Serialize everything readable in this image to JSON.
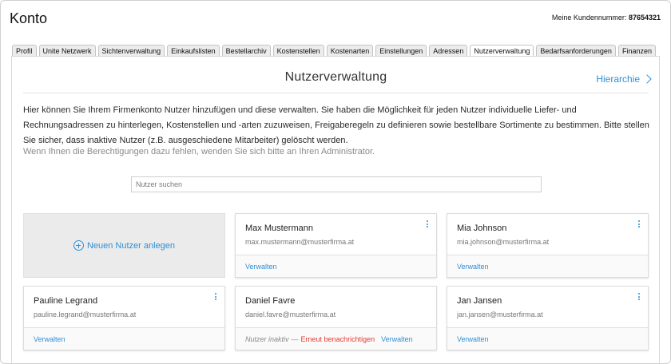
{
  "header": {
    "title": "Konto",
    "customer_label": "Meine Kundennummer:",
    "customer_number": "87654321"
  },
  "tabs": [
    {
      "label": "Profil"
    },
    {
      "label": "Unite Netzwerk"
    },
    {
      "label": "Sichtenverwaltung"
    },
    {
      "label": "Einkaufslisten"
    },
    {
      "label": "Bestellarchiv"
    },
    {
      "label": "Kostenstellen"
    },
    {
      "label": "Kostenarten"
    },
    {
      "label": "Einstellungen"
    },
    {
      "label": "Adressen"
    },
    {
      "label": "Nutzerverwaltung",
      "active": true
    },
    {
      "label": "Bedarfsanforderungen"
    },
    {
      "label": "Finanzen"
    }
  ],
  "section": {
    "title": "Nutzerverwaltung",
    "hierarchy_link": "Hierarchie"
  },
  "intro": {
    "text": "Hier können Sie Ihrem Firmenkonto Nutzer hinzufügen und diese verwalten. Sie haben die Möglichkeit für jeden Nutzer individuelle Liefer- und Rechnungsadressen zu hinterlegen, Kostenstellen und -arten zuzuweisen, Freigaberegeln zu definieren sowie bestellbare Sortimente zu bestimmen. Bitte stellen Sie sicher, dass inaktive Nutzer (z.B. ausgeschiedene Mitarbeiter) gelöscht werden.",
    "note": "Wenn Ihnen die Berechtigungen dazu fehlen, wenden Sie sich bitte an Ihren Administrator."
  },
  "search": {
    "placeholder": "Nutzer suchen"
  },
  "new_user": {
    "label": "Neuen Nutzer anlegen"
  },
  "users": [
    {
      "name": "Max Mustermann",
      "email": "max.mustermann@musterfirma.at",
      "manage": "Verwalten"
    },
    {
      "name": "Mia Johnson",
      "email": "mia.johnson@musterfirma.at",
      "manage": "Verwalten"
    },
    {
      "name": "Pauline Legrand",
      "email": "pauline.legrand@musterfirma.at",
      "manage": "Verwalten"
    },
    {
      "name": "Daniel Favre",
      "email": "daniel.favre@musterfirma.at",
      "manage": "Verwalten",
      "inactive_label": "Nutzer inaktiv",
      "dash": "—",
      "renotify": "Erneut benachrichtigen"
    },
    {
      "name": "Jan Jansen",
      "email": "jan.jansen@musterfirma.at",
      "manage": "Verwalten"
    }
  ],
  "colors": {
    "accent": "#2f8fd6",
    "warning": "#e23b2e"
  }
}
